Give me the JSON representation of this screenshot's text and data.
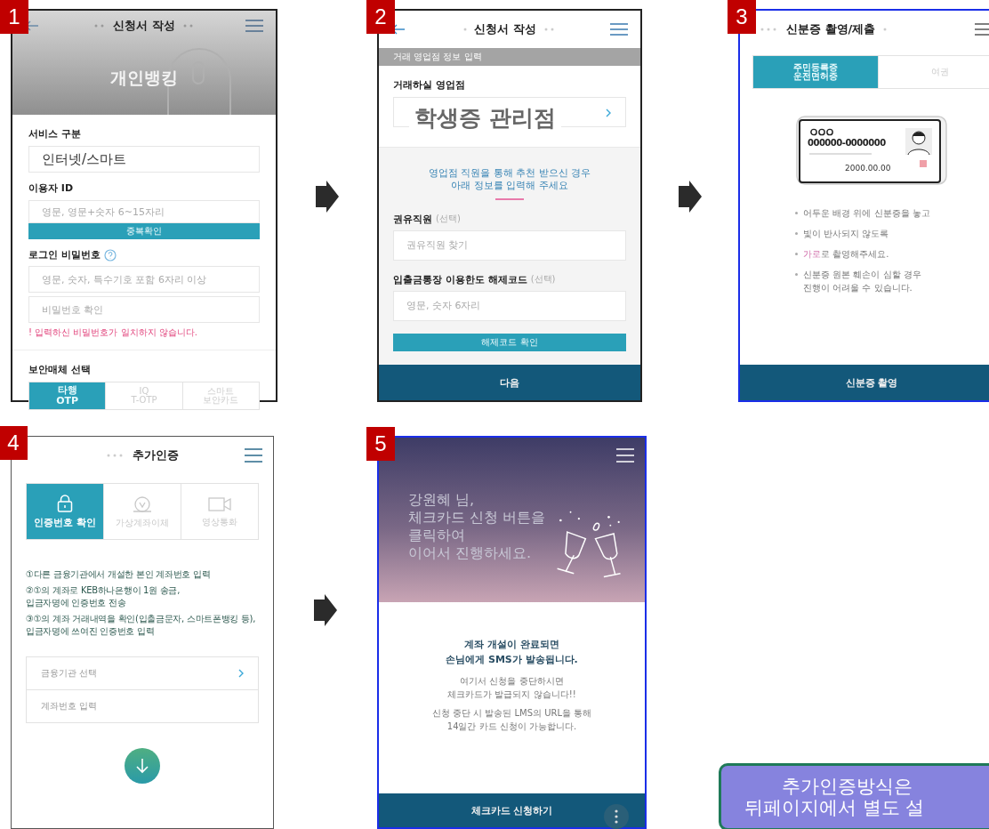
{
  "screen_1": {
    "number": "1",
    "title": "신청서 작성",
    "banner": "개인뱅킹",
    "service_label": "서비스 구분",
    "service_value": "인터넷/스마트",
    "id_label": "이용자 ID",
    "id_placeholder": "영문, 영문+숫자 6~15자리",
    "id_check_button": "중복확인",
    "password_label": "로그인 비밀번호",
    "password_placeholder": "영문, 숫자, 특수기호 포함 6자리 이상",
    "confirm_placeholder": "비밀번호 확인",
    "error": "! 입력하신 비밀번호가 일치하지 않습니다.",
    "security_label": "보안매체 선택",
    "security_tabs": [
      {
        "label": "타행\nOTP",
        "selected": true
      },
      {
        "label": "IQ\nT-OTP",
        "selected": false
      },
      {
        "label": "스마트\n보안카드",
        "selected": false
      }
    ]
  },
  "screen_2": {
    "number": "2",
    "title": "신청서 작성",
    "section_bar": "거래 영업점 정보 입력",
    "branch_label": "거래하실 영업점",
    "overlay_text": "학생증 관리점",
    "notice": "영업점 직원을 통해 추천 받으신 경우\n아래 정보를 입력해 주세요",
    "staff_label": "권유직원",
    "staff_optional": "(선택)",
    "staff_placeholder": "권유직원 찾기",
    "code_label": "입출금통장 이용한도 해제코드",
    "code_optional": "(선택)",
    "code_placeholder": "영문, 숫자 6자리",
    "code_button": "해제코드 확인",
    "next_button": "다음"
  },
  "screen_3": {
    "number": "3",
    "title": "신분증 촬영/제출",
    "tabs": [
      {
        "label": "주민등록증\n운전면허증",
        "selected": true
      },
      {
        "label": "여권",
        "selected": false
      }
    ],
    "card_number": "000000-0000000",
    "card_date": "2000.00.00",
    "bullets": [
      {
        "text": "어두운 배경 위에 신분증을 놓고"
      },
      {
        "text": "빛이 반사되지 않도록"
      },
      {
        "highlight": "가로",
        "text": "로 촬영해주세요."
      },
      {
        "text": "신분증 원본 훼손이 심할 경우\n진행이 어려울 수 있습니다."
      }
    ],
    "button": "신분증 촬영"
  },
  "screen_4": {
    "number": "4",
    "title": "추가인증",
    "tabs": [
      {
        "label": "인증번호 확인",
        "kind": "lock",
        "selected": true
      },
      {
        "label": "가상계좌이체",
        "kind": "coin",
        "selected": false
      },
      {
        "label": "영상통화",
        "kind": "video",
        "selected": false
      }
    ],
    "steps": [
      "①다른 금융기관에서 개설한 본인 계좌번호 입력",
      "②①의 계좌로 KEB하나은행이 1원 송금,\n입금자명에 인증번호 전송",
      "③①의 계좌 거래내역을 확인(입출금문자, 스마트폰뱅킹 등), 입금자명에 쓰여진 인증번호 입력"
    ],
    "bank_select": "금융기관 선택",
    "account_placeholder": "계좌번호 입력"
  },
  "screen_5": {
    "number": "5",
    "greeting": "강원혜 님,\n체크카드 신청 버튼을\n클릭하여\n이어서 진행하세요.",
    "headline": "계좌 개설이 완료되면\n손님에게 SMS가 발송됩니다.",
    "note_1": "여기서 신청을 중단하시면\n체크카드가 발급되지 않습니다!!",
    "note_2": "신청 중단 시 발송된 LMS의 URL을 통해\n14일간 카드 신청이 가능합니다.",
    "button": "체크카드 신청하기"
  },
  "callout": [
    "추가인증방식은",
    "뒤페이지에서 별도 설"
  ]
}
